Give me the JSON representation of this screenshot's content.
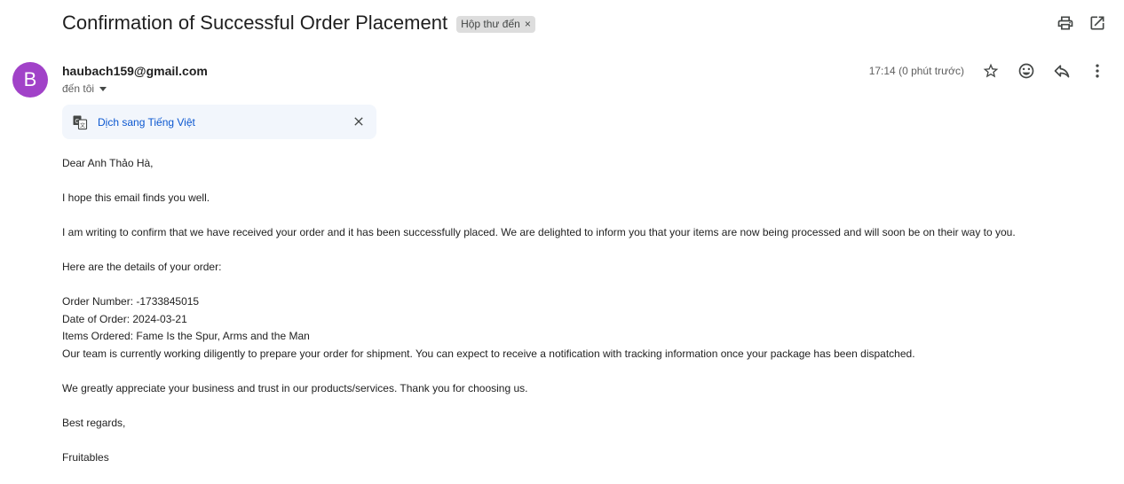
{
  "email": {
    "subject": "Confirmation of Successful Order Placement",
    "label_chip": "Hộp thư đến",
    "label_remove": "×",
    "sender_initial": "B",
    "sender": "haubach159@gmail.com",
    "to": "đến tôi",
    "time": "17:14 (0 phút trước)",
    "translate_link": "Dịch sang Tiếng Việt",
    "body": {
      "greeting": "Dear Anh Thảo Hà,",
      "p1": "I hope this email finds you well.",
      "p2": "I am writing to confirm that we have received your order and it has been successfully placed. We are delighted to inform you that your items are now being processed and will soon be on their way to you.",
      "p3": "Here are the details of your order:",
      "order_number": "Order Number: -1733845015",
      "order_date": "Date of Order: 2024-03-21",
      "items": "Items Ordered: Fame Is the Spur, Arms and the Man",
      "p4": "Our team is currently working diligently to prepare your order for shipment. You can expect to receive a notification with tracking information once your package has been dispatched.",
      "p5": "We greatly appreciate your business and trust in our products/services. Thank you for choosing us.",
      "closing": "Best regards,",
      "signature": "Fruitables"
    }
  },
  "icons": {
    "print": "print-icon",
    "open_new": "open-in-new-window-icon",
    "star": "star-icon",
    "emoji": "emoji-reaction-icon",
    "reply": "reply-icon",
    "more": "more-vertical-icon",
    "translate": "translate-icon",
    "close": "close-icon",
    "caret": "caret-down-icon"
  },
  "colors": {
    "avatar": "#a142c8",
    "link": "#0b57d0",
    "translate_bg": "#f2f6fc",
    "chip_bg": "#dddddd"
  }
}
